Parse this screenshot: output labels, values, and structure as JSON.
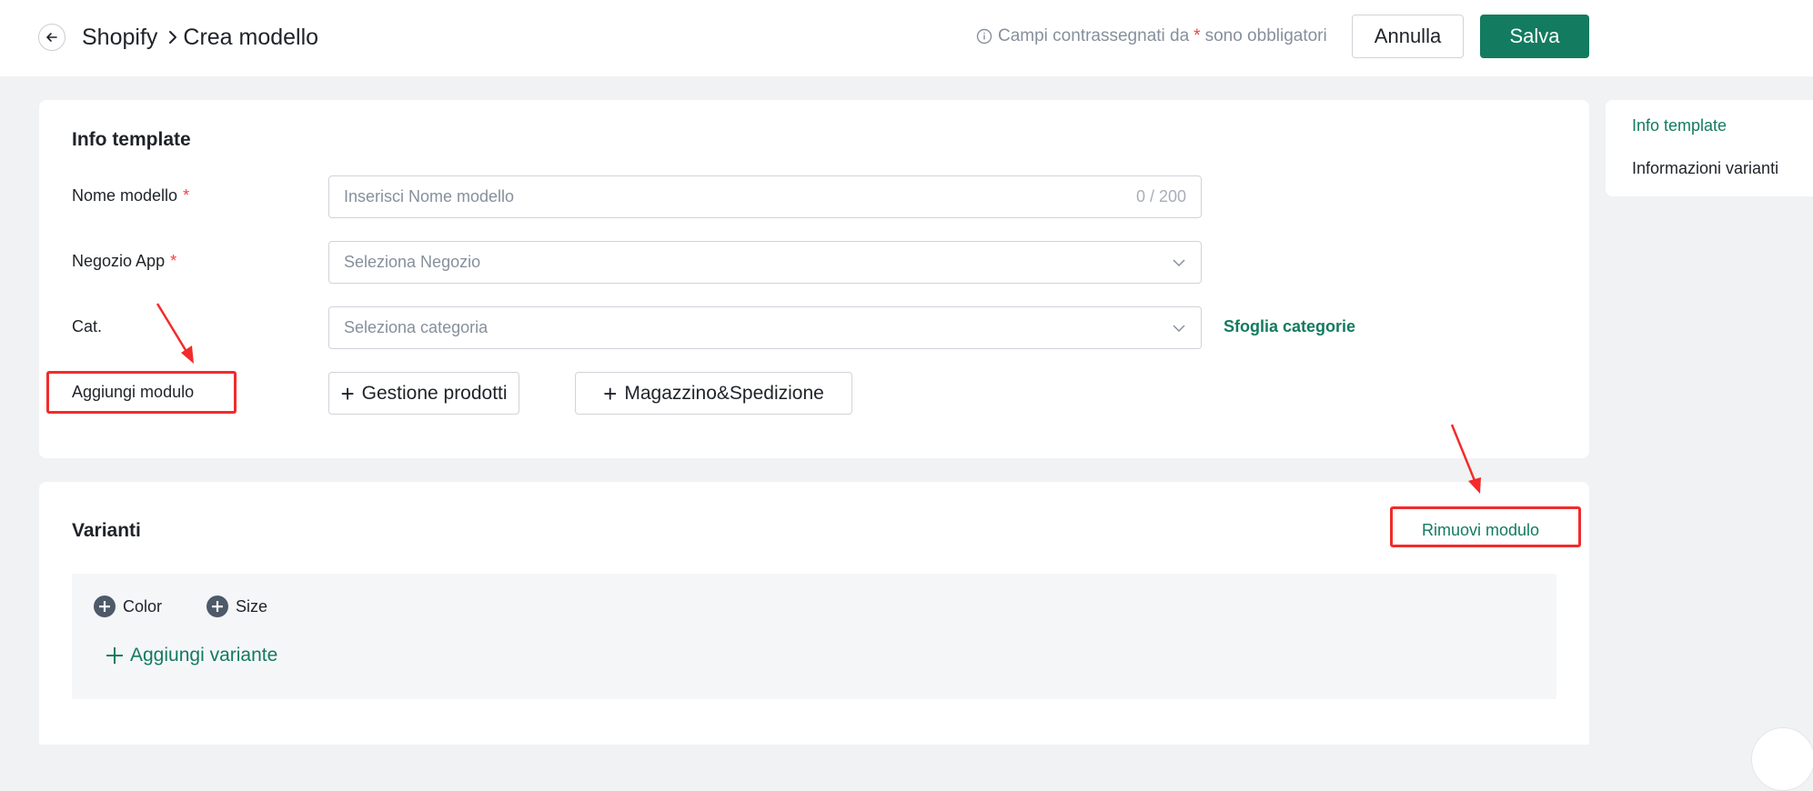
{
  "header": {
    "breadcrumb_root": "Shopify",
    "breadcrumb_current": "Crea modello",
    "hint_prefix": "Campi contrassegnati da",
    "hint_star": "*",
    "hint_suffix": "sono obbligatori",
    "cancel_label": "Annulla",
    "save_label": "Salva"
  },
  "info_card": {
    "title": "Info template",
    "fields": {
      "name_label": "Nome modello",
      "name_placeholder": "Inserisci Nome modello",
      "name_counter": "0 / 200",
      "store_label": "Negozio App",
      "store_placeholder": "Seleziona Negozio",
      "category_label": "Cat.",
      "category_placeholder": "Seleziona categoria",
      "browse_categories": "Sfoglia categorie",
      "required_star": "*"
    },
    "add_module_label": "Aggiungi modulo",
    "modules": [
      "Gestione prodotti",
      "Magazzino&Spedizione"
    ]
  },
  "variants_card": {
    "title": "Varianti",
    "remove_module": "Rimuovi modulo",
    "options": [
      "Color",
      "Size"
    ],
    "add_variant": "Aggiungi variante"
  },
  "side_nav": {
    "items": [
      "Info template",
      "Informazioni varianti"
    ],
    "active_index": 0
  },
  "colors": {
    "brand_green": "#137b5f",
    "required_red": "#f53f3f",
    "annotation_red": "#f22b2b"
  }
}
